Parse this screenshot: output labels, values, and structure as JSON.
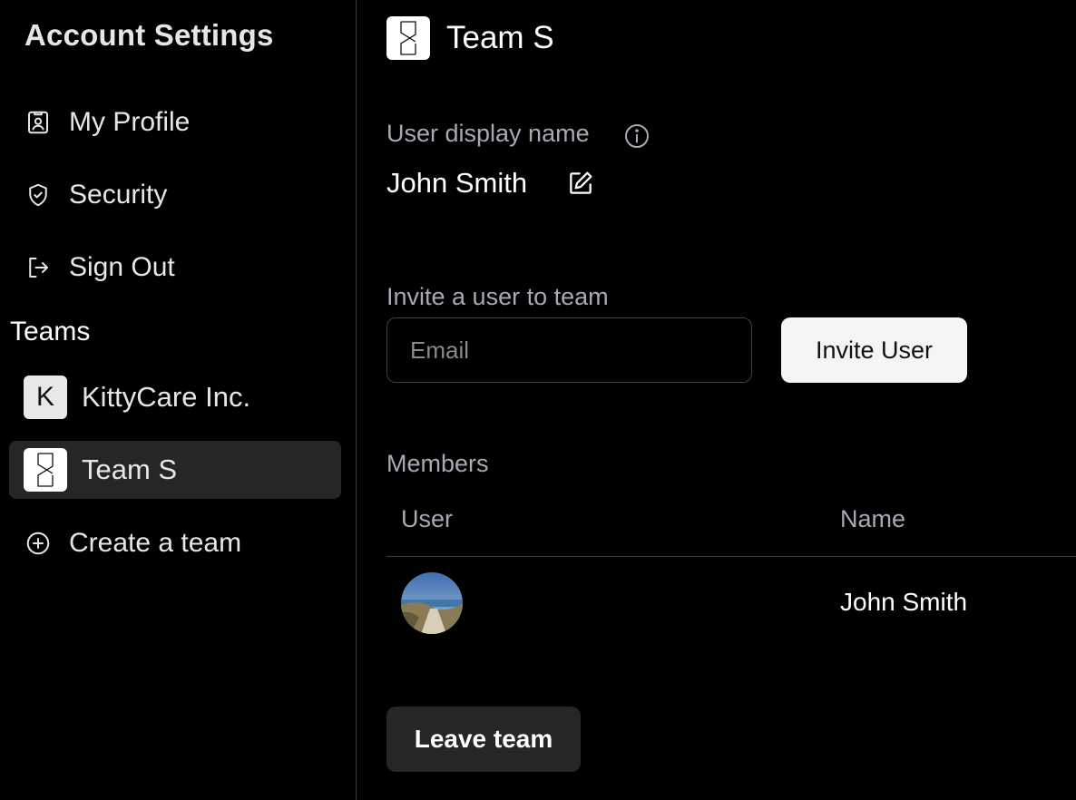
{
  "sidebar": {
    "title": "Account Settings",
    "items": [
      {
        "label": "My Profile",
        "icon": "profile-badge-icon"
      },
      {
        "label": "Security",
        "icon": "shield-check-icon"
      },
      {
        "label": "Sign Out",
        "icon": "sign-out-icon"
      }
    ],
    "teams_heading": "Teams",
    "teams": [
      {
        "label": "KittyCare Inc.",
        "logo_text": "K",
        "active": false
      },
      {
        "label": "Team S",
        "logo_text": "",
        "active": true
      }
    ],
    "create_team_label": "Create a team"
  },
  "main": {
    "team_name": "Team S",
    "display_name_label": "User display name",
    "display_name": "John Smith",
    "invite_label": "Invite a user to team",
    "email_placeholder": "Email",
    "email_value": "",
    "invite_button": "Invite User",
    "members_label": "Members",
    "columns": [
      "User",
      "Name"
    ],
    "members": [
      {
        "name": "John Smith",
        "avatar": "landscape-photo"
      }
    ],
    "leave_button": "Leave team"
  },
  "colors": {
    "background": "#000000",
    "muted_text": "#a7aab4",
    "active_row": "#262626",
    "primary_button": "#f5f5f5"
  }
}
